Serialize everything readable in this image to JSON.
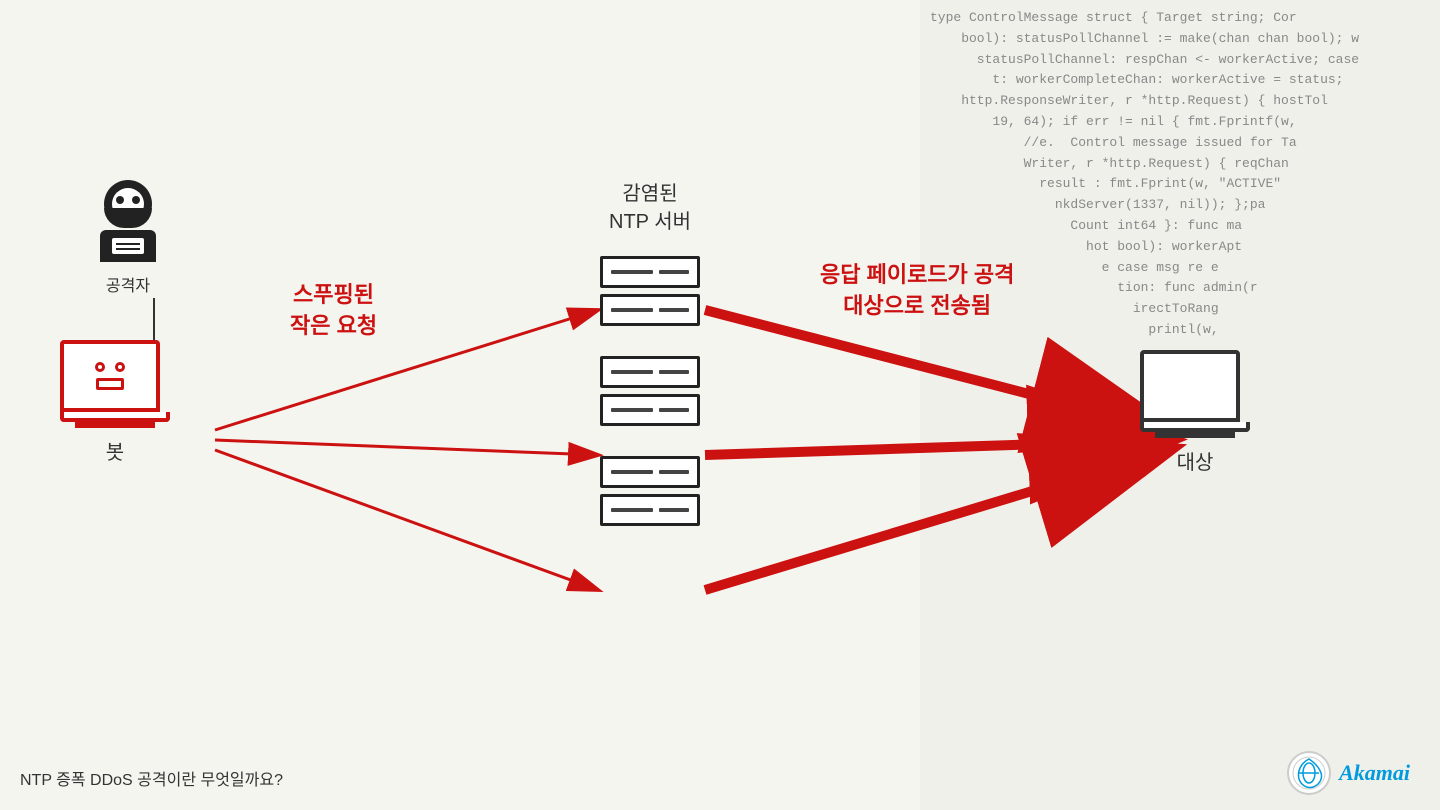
{
  "code_bg": {
    "lines": [
      "type ControlMessage struct { Target string; Cor",
      "bool): statusPollChannel := make(chan chan bool); w",
      "statusPollChannel: respChan <- workerActive; case",
      "t: workerCompleteChan: workerActive = status;",
      "http.ResponseWriter, r *http.Request) { hostTol",
      "19, 64); if err != nil { fmt.Fprintf(w,",
      "//e. Control message issued for Ta",
      "Writer, r *http.Request) { reqChan",
      "result : fmt.Fprint(w, \"ACTIVE\"",
      "nkdServer(1337, nil)); };pa",
      "Count int64 }: func ma",
      "hot bool): workerApt",
      "e case msg re e",
      "tion: func admin(r",
      "irectToRang",
      "printl(w,",
      "",
      "",
      "",
      "",
      "",
      ""
    ]
  },
  "attacker": {
    "label": "공격자"
  },
  "bot": {
    "label": "봇"
  },
  "infected_servers": {
    "label_line1": "감염된",
    "label_line2": "NTP 서버"
  },
  "target": {
    "label": "대상"
  },
  "spoofed_label": {
    "line1": "스푸핑된",
    "line2": "작은 요청"
  },
  "response_label": {
    "line1": "응답 페이로드가 공격",
    "line2": "대상으로 전송됨"
  },
  "bottom_text": "NTP 증폭 DDoS 공격이란 무엇일까요?",
  "akamai": {
    "text": "Akamai"
  }
}
